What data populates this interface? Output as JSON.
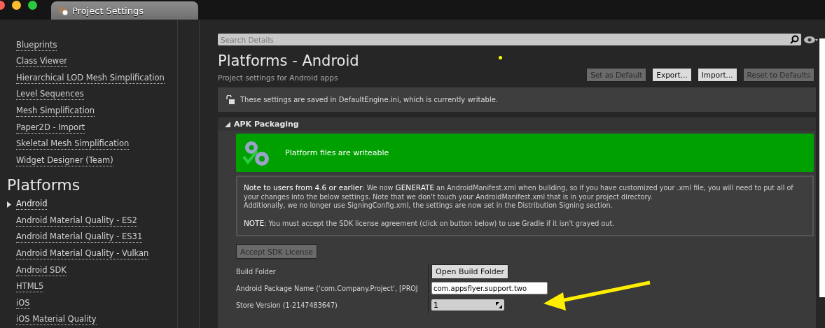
{
  "window": {
    "tab_title": "Project Settings"
  },
  "sidebar": {
    "sections": [
      {
        "items": [
          {
            "label": "Blueprints",
            "selected": false
          },
          {
            "label": "Class Viewer",
            "selected": false
          },
          {
            "label": "Hierarchical LOD Mesh Simplification",
            "selected": false
          },
          {
            "label": "Level Sequences",
            "selected": false
          },
          {
            "label": "Mesh Simplification",
            "selected": false
          },
          {
            "label": "Paper2D - Import",
            "selected": false
          },
          {
            "label": "Skeletal Mesh Simplification",
            "selected": false
          },
          {
            "label": "Widget Designer (Team)",
            "selected": false
          }
        ]
      },
      {
        "heading": "Platforms",
        "items": [
          {
            "label": "Android",
            "selected": true
          },
          {
            "label": "Android Material Quality - ES2",
            "selected": false
          },
          {
            "label": "Android Material Quality - ES31",
            "selected": false
          },
          {
            "label": "Android Material Quality - Vulkan",
            "selected": false
          },
          {
            "label": "Android SDK",
            "selected": false
          },
          {
            "label": "HTML5",
            "selected": false
          },
          {
            "label": "iOS",
            "selected": false
          },
          {
            "label": "iOS Material Quality",
            "selected": false
          }
        ]
      }
    ]
  },
  "details": {
    "search": {
      "placeholder": "Search Details"
    },
    "title": "Platforms - Android",
    "subtitle": "Project settings for Android apps",
    "buttons": [
      {
        "label": "Set as Default",
        "disabled": true
      },
      {
        "label": "Export...",
        "disabled": false
      },
      {
        "label": "Import...",
        "disabled": false
      },
      {
        "label": "Reset to Defaults",
        "disabled": true
      }
    ],
    "notice": "These settings are saved in DefaultEngine.ini, which is currently writable.",
    "section": {
      "title": "APK Packaging",
      "expanded": true
    },
    "banner": "Platform files are writeable",
    "note": [
      "**Note to users from 4.6 or earlier**: We now **GENERATE** an AndroidManifest.xml when building, so if you have customized your .xml file, you will need to put all of your changes into the below settings. Note that we don't touch your AndroidManifest.xml that is in your project directory.",
      "Additionally, we no longer use SigningConfig.xml, the settings are now set in the Distribution Signing section.",
      "**NOTE**: You must accept the SDK license agreement (click on button below) to use Gradle if it isn't grayed out."
    ],
    "accept_button": {
      "label": "Accept SDK License",
      "disabled": true
    },
    "properties": [
      {
        "label": "Build Folder",
        "kind": "button",
        "value": "Open Build Folder"
      },
      {
        "label": "Android Package Name ('com.Company.Project', [PROJ",
        "kind": "text",
        "value": "com.appsflyer.support.two"
      },
      {
        "label": "Store Version (1-2147483647)",
        "kind": "number",
        "value": "1"
      }
    ]
  }
}
